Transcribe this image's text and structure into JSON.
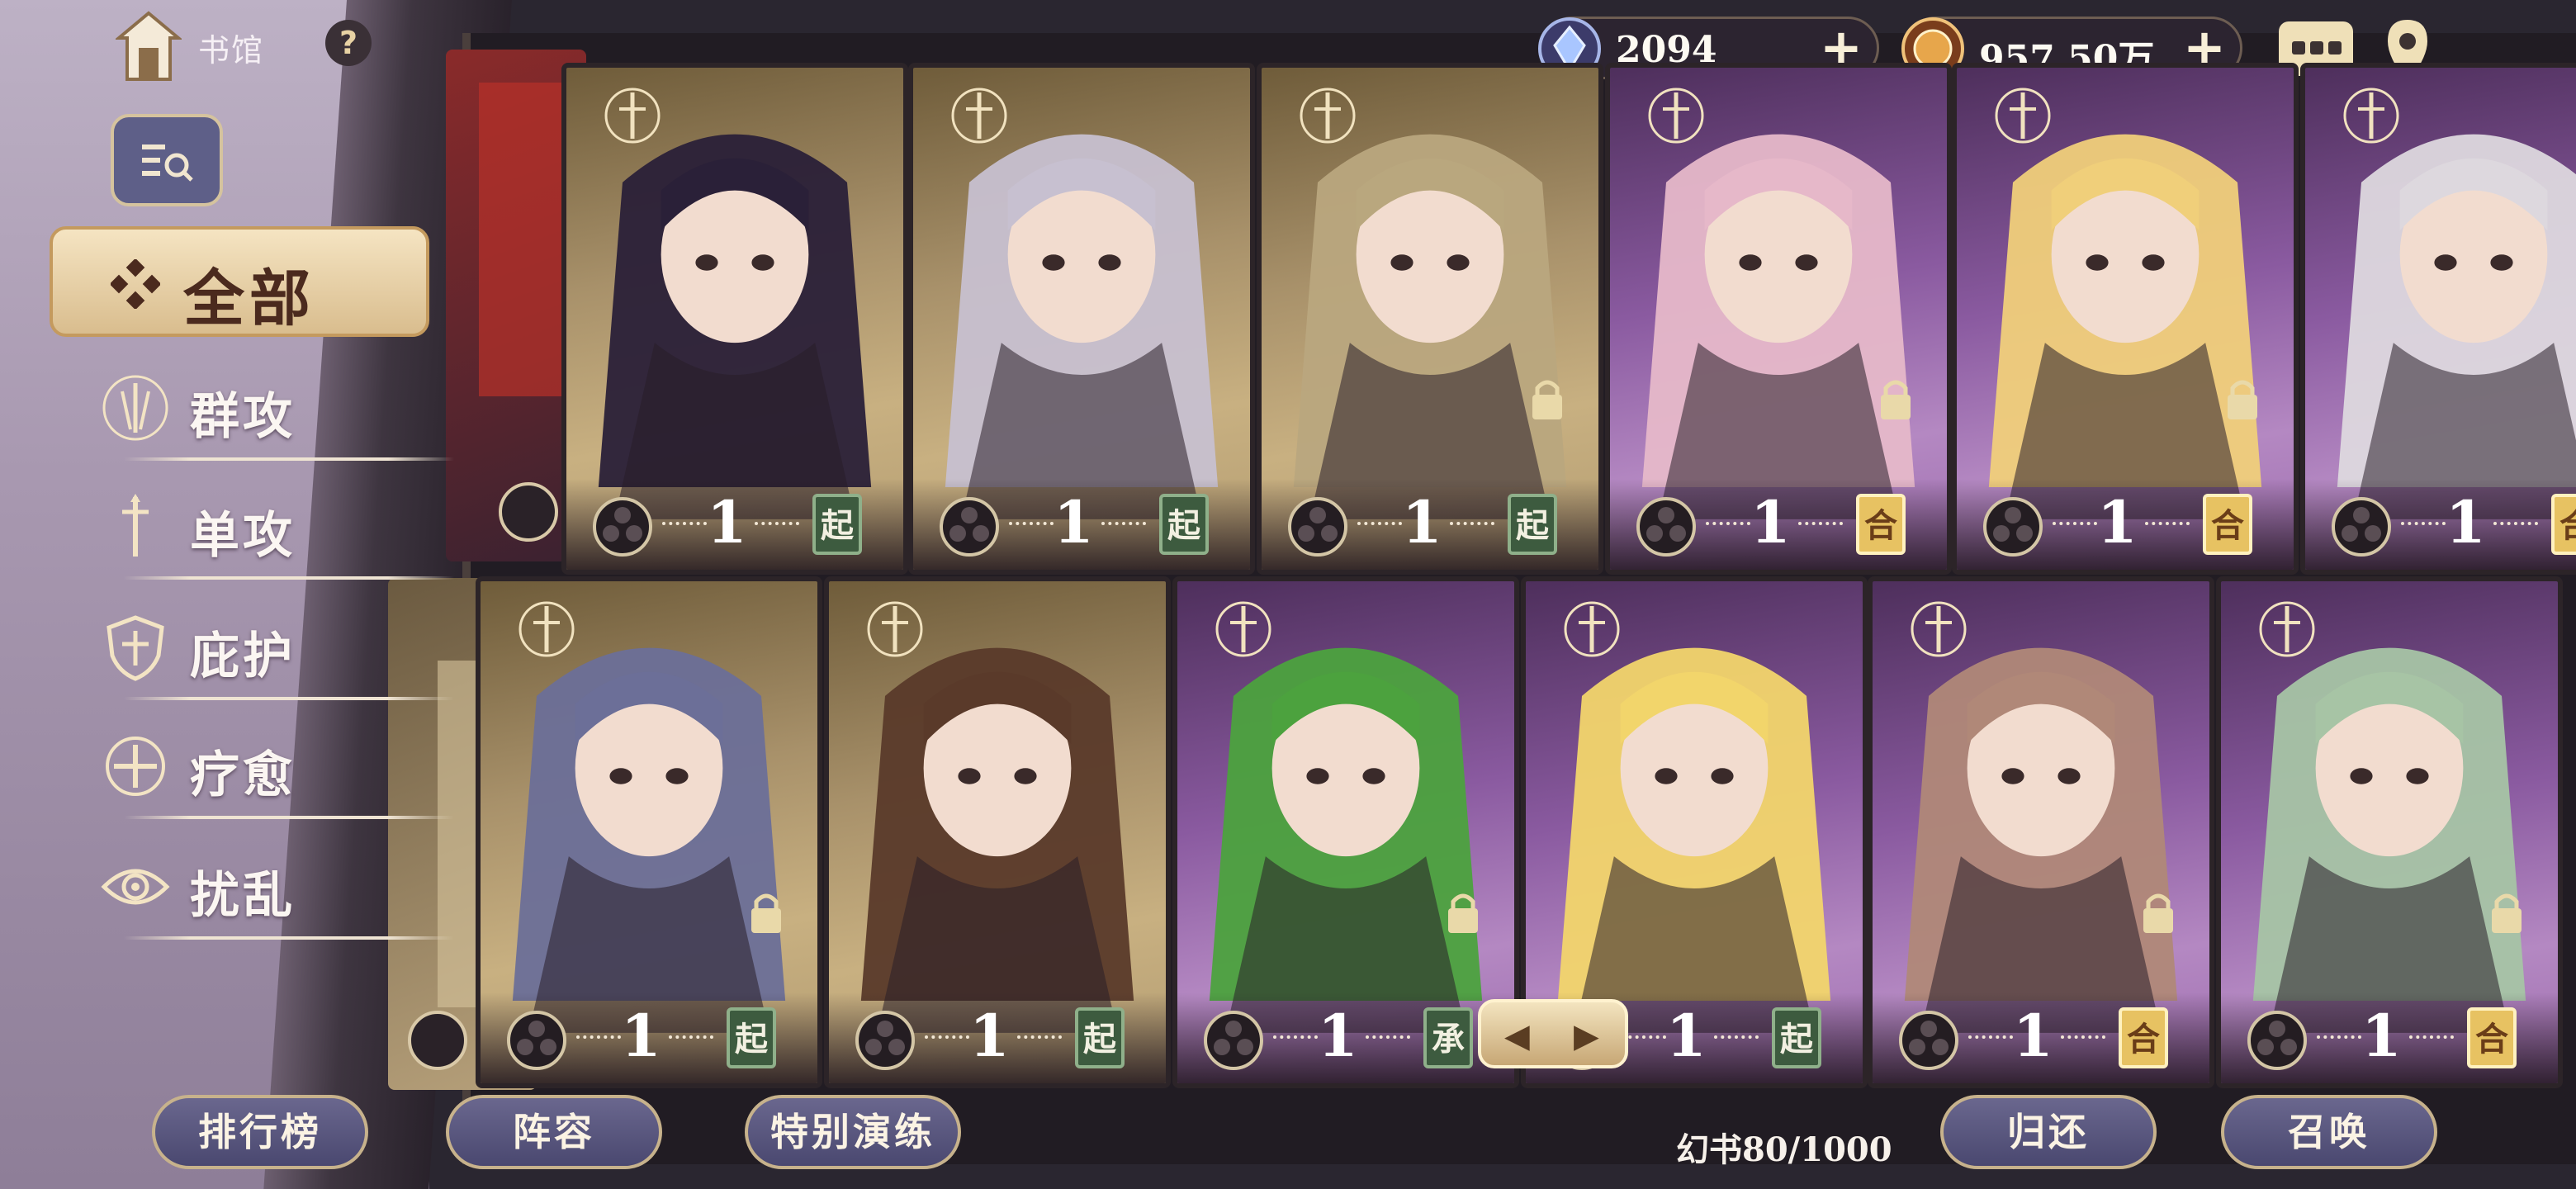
{
  "nav": {
    "library_label": "书馆",
    "help_symbol": "?",
    "filter_icon": "list-search-icon"
  },
  "categories": {
    "all_label": "全部",
    "items": [
      {
        "label": "群攻",
        "icon": "group-attack-icon"
      },
      {
        "label": "单攻",
        "icon": "single-attack-icon"
      },
      {
        "label": "庇护",
        "icon": "shield-icon"
      },
      {
        "label": "疗愈",
        "icon": "heal-icon"
      },
      {
        "label": "扰乱",
        "icon": "eye-disrupt-icon"
      }
    ]
  },
  "currency": {
    "gems": "2094",
    "coins": "957.50万",
    "plus": "+"
  },
  "cards": {
    "row1": [
      {
        "level": "1",
        "tag": "起",
        "tag_style": "green",
        "theme": "gold",
        "locked": false,
        "class_icon": "heal-icon"
      },
      {
        "level": "1",
        "tag": "起",
        "tag_style": "green",
        "theme": "gold",
        "locked": false,
        "class_icon": "eye-disrupt-icon"
      },
      {
        "level": "1",
        "tag": "起",
        "tag_style": "green",
        "theme": "gold",
        "locked": true,
        "class_icon": "eye-disrupt-icon"
      },
      {
        "level": "1",
        "tag": "合",
        "tag_style": "yellow",
        "theme": "purple",
        "locked": true,
        "class_icon": "single-attack-icon"
      },
      {
        "level": "1",
        "tag": "合",
        "tag_style": "yellow",
        "theme": "purple",
        "locked": true,
        "class_icon": "single-attack-icon"
      },
      {
        "level": "1",
        "tag": "合",
        "tag_style": "yellow",
        "theme": "purple",
        "locked": true,
        "class_icon": "single-attack-icon"
      }
    ],
    "row2": [
      {
        "level": "1",
        "tag": "起",
        "tag_style": "green",
        "theme": "gold",
        "locked": true,
        "class_icon": "group-attack-icon"
      },
      {
        "level": "1",
        "tag": "起",
        "tag_style": "green",
        "theme": "gold",
        "locked": false,
        "class_icon": "group-attack-icon"
      },
      {
        "level": "1",
        "tag": "承",
        "tag_style": "green",
        "theme": "purple",
        "locked": true,
        "class_icon": "group-attack-icon"
      },
      {
        "level": "1",
        "tag": "起",
        "tag_style": "green",
        "theme": "purple",
        "locked": false,
        "class_icon": "group-attack-icon"
      },
      {
        "level": "1",
        "tag": "合",
        "tag_style": "yellow",
        "theme": "purple",
        "locked": true,
        "class_icon": "single-attack-icon"
      },
      {
        "level": "1",
        "tag": "合",
        "tag_style": "yellow",
        "theme": "purple",
        "locked": true,
        "class_icon": "group-attack-icon"
      }
    ]
  },
  "bottom": {
    "ranking": "排行榜",
    "lineup": "阵容",
    "training": "特别演练",
    "capacity": "幻书80/1000",
    "return": "归还",
    "summon": "召唤"
  },
  "pager": {
    "prev": "◀",
    "next": "▶"
  }
}
